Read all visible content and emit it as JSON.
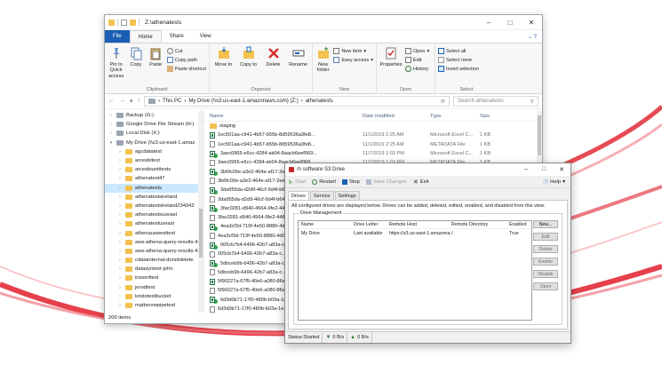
{
  "colors": {
    "file_tab": "#1a5fb4",
    "selection": "#cce8ff",
    "folder": "#f2c14e",
    "swoosh": "#e01e2b",
    "sync_ok": "#2fa84f"
  },
  "explorer": {
    "title": "Z:\\athenatests",
    "tabs": [
      "File",
      "Home",
      "Share",
      "View"
    ],
    "ribbon": {
      "clipboard": {
        "pin": "Pin to Quick access",
        "copy": "Copy",
        "paste": "Paste",
        "cut": "Cut",
        "copy_path": "Copy path",
        "paste_shortcut": "Paste shortcut",
        "label": "Clipboard"
      },
      "organize": {
        "move_to": "Move to",
        "copy_to": "Copy to",
        "delete": "Delete",
        "rename": "Rename",
        "label": "Organize"
      },
      "new": {
        "new_folder": "New folder",
        "new_item": "New item",
        "easy_access": "Easy access",
        "label": "New"
      },
      "open": {
        "properties": "Properties",
        "open": "Open",
        "edit": "Edit",
        "history": "History",
        "label": "Open"
      },
      "select": {
        "select_all": "Select all",
        "select_none": "Select none",
        "invert": "Invert selection",
        "label": "Select"
      }
    },
    "address": {
      "segments": [
        "This PC",
        "My Drive (\\\\s3.us-east-1.amazonaws.com) (Z:)",
        "athenatests"
      ],
      "search_placeholder": "Search athenatests"
    },
    "nav": [
      {
        "label": "Backup (G:)",
        "type": "drive",
        "indent": 0
      },
      {
        "label": "Google Drive File Stream (H:)",
        "type": "drive",
        "indent": 0
      },
      {
        "label": "Local Disk (X:)",
        "type": "drive",
        "indent": 0
      },
      {
        "label": "My Drive (\\\\s3.us-east-1.amaz",
        "type": "drive",
        "indent": 0
      },
      {
        "label": "agcdatatest",
        "type": "folder",
        "indent": 1
      },
      {
        "label": "arcesbitest",
        "type": "folder",
        "indent": 1
      },
      {
        "label": "arcesbiunittests",
        "type": "folder",
        "indent": 1
      },
      {
        "label": "athenatest47",
        "type": "folder",
        "indent": 1
      },
      {
        "label": "athenatests",
        "type": "folder",
        "indent": 1,
        "selected": true
      },
      {
        "label": "athenatestsireland",
        "type": "folder",
        "indent": 1
      },
      {
        "label": "athenatestsireland234342",
        "type": "folder",
        "indent": 1
      },
      {
        "label": "athenatestsuseast",
        "type": "folder",
        "indent": 1
      },
      {
        "label": "athenatestuseast",
        "type": "folder",
        "indent": 1
      },
      {
        "label": "athenauswesttest",
        "type": "folder",
        "indent": 1
      },
      {
        "label": "aws-athena-query-results-42",
        "type": "folder",
        "indent": 1
      },
      {
        "label": "aws-athena-query-results-42",
        "type": "folder",
        "indent": 1
      },
      {
        "label": "cdatainternal-donotdelete",
        "type": "folder",
        "indent": 1
      },
      {
        "label": "datasyntest-john",
        "type": "folder",
        "indent": 1
      },
      {
        "label": "insserttest",
        "type": "folder",
        "indent": 1
      },
      {
        "label": "jerodtest",
        "type": "folder",
        "indent": 1
      },
      {
        "label": "kristotestbucket",
        "type": "folder",
        "indent": 1
      },
      {
        "label": "mattsnowpipetest",
        "type": "folder",
        "indent": 1
      }
    ],
    "columns": {
      "name": "Name",
      "date": "Date modified",
      "type": "Type",
      "size": "Size"
    },
    "files": [
      {
        "name": "staging",
        "date": "",
        "type": "",
        "size": "",
        "icon": "folder"
      },
      {
        "name": "1ec501aa-c941-4b57-b55b-8d59536a3fe8...",
        "date": "11/1/2019 2:25 AM",
        "type": "Microsoft Excel C...",
        "size": "1 KB",
        "icon": "excel"
      },
      {
        "name": "1ec501aa-c941-4b57-b55b-8d59536a3fe8...",
        "date": "11/1/2019 2:25 AM",
        "type": "METADATA File",
        "size": "1 KB",
        "icon": "meta"
      },
      {
        "name": "3aec0965-e6cc-4284-ab04-8aacb6eef069...",
        "date": "11/7/2019 1:03 PM",
        "type": "Microsoft Excel C...",
        "size": "1 KB",
        "icon": "excel",
        "synced": true
      },
      {
        "name": "3aec0965-e6cc-4284-ab04-8aacb6eef069...",
        "date": "11/7/2019 1:03 PM",
        "type": "METADATA File",
        "size": "1 KB",
        "icon": "meta"
      },
      {
        "name": "3b6fc00e-a3e2-464e-af17-2ee30af31a3e.c...",
        "date": "11/7/2019 1:04 PM",
        "type": "Microsoft Excel C...",
        "size": "1 KB",
        "icon": "excel",
        "synced": true
      },
      {
        "name": "3b6fc00e-a3e2-464e-af17-2ee30af31a3e...",
        "date": "11/7/2019 1:04 PM",
        "type": "METADATA File",
        "size": "1 KB",
        "icon": "meta"
      },
      {
        "name": "3da955da-d2d9-46cf-9d4f-b64f...",
        "date": "",
        "type": "",
        "size": "",
        "icon": "excel",
        "synced": true
      },
      {
        "name": "3da955da-d2d9-46cf-9d4f-b64f...",
        "date": "",
        "type": "",
        "size": "",
        "icon": "meta"
      },
      {
        "name": "3fac0281-d940-4564-9fe2-4484...",
        "date": "",
        "type": "",
        "size": "",
        "icon": "excel",
        "synced": true
      },
      {
        "name": "3fac0281-d940-4564-9fe2-4484...",
        "date": "",
        "type": "",
        "size": "",
        "icon": "meta"
      },
      {
        "name": "4ea3cf3d-719f-4e50-8880-4d0e...",
        "date": "",
        "type": "",
        "size": "",
        "icon": "excel",
        "synced": true
      },
      {
        "name": "4ea3cf3d-719f-4e50-8880-4d0e...",
        "date": "",
        "type": "",
        "size": "",
        "icon": "meta"
      },
      {
        "name": "005cb7b4-6496-42b7-a83a-c...",
        "date": "",
        "type": "",
        "size": "",
        "icon": "excel",
        "synced": true
      },
      {
        "name": "005cb7b4-6496-42b7-a83a-c...",
        "date": "",
        "type": "",
        "size": "",
        "icon": "meta"
      },
      {
        "name": "5dbceb9b-6496-42b7-a83a-c...",
        "date": "",
        "type": "",
        "size": "",
        "icon": "excel",
        "synced": true
      },
      {
        "name": "5dbceb9b-6496-42b7-a83a-c...",
        "date": "",
        "type": "",
        "size": "",
        "icon": "meta"
      },
      {
        "name": "5f90227a-67f5-40e6-a080-86efc...",
        "date": "",
        "type": "",
        "size": "",
        "icon": "excel"
      },
      {
        "name": "5f90227a-67f5-40e6-a080-86efc...",
        "date": "",
        "type": "",
        "size": "",
        "icon": "meta"
      },
      {
        "name": "6d3d0b71-17f0-480b-b03a-1e1...",
        "date": "",
        "type": "",
        "size": "",
        "icon": "excel",
        "synced": true
      },
      {
        "name": "6d3d0b71-17f0-480b-b03a-1e1...",
        "date": "",
        "type": "",
        "size": "",
        "icon": "meta"
      },
      {
        "name": "6f97bc3a-dee8-46fb-a97e-1b...",
        "date": "",
        "type": "",
        "size": "",
        "icon": "excel"
      },
      {
        "name": "6f97bc3a-dee8-46fb-a97e-1b...",
        "date": "",
        "type": "",
        "size": "",
        "icon": "meta"
      }
    ],
    "status": "200 items"
  },
  "s3": {
    "title": "/n software S3 Drive",
    "toolbar": {
      "start": "Start",
      "restart": "Restart",
      "stop": "Stop",
      "save": "Save Changes",
      "exit": "Exit",
      "help": "Help"
    },
    "tabs": [
      "Drives",
      "Service",
      "Settings"
    ],
    "description": "All configured drives are displayed below. Drives can be added, deleted, edited, enabled, and disabled from this view.",
    "group_title": "Drive Management",
    "columns": {
      "name": "Name",
      "letter": "Drive Letter",
      "host": "Remote Host",
      "dir": "Remote Directory",
      "enabled": "Enabled"
    },
    "drives": [
      {
        "name": "My Drive",
        "letter": "Last available",
        "host": "https://s3.us-east-1.amazona...",
        "dir": "/",
        "enabled": "True"
      }
    ],
    "buttons": {
      "new": "New...",
      "edit": "Edit",
      "delete": "Delete",
      "enable": "Enable",
      "disable": "Disable",
      "open": "Open"
    },
    "status": {
      "state": "Status:Started",
      "down": "0 B/s",
      "up": "0 B/s"
    }
  }
}
